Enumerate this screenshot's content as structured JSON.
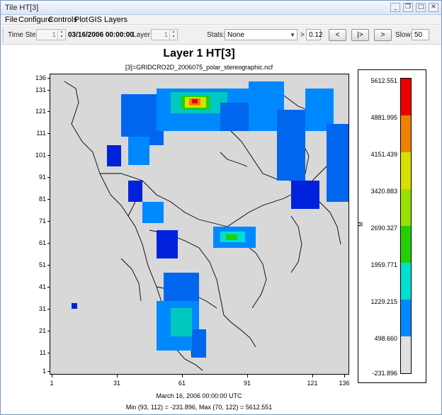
{
  "window": {
    "title": "Tile HT[3]",
    "minimize_glyph": "_",
    "restore_glyph": "❐",
    "maximize_glyph": "□",
    "close_glyph": "✕"
  },
  "menu": [
    {
      "label": "File"
    },
    {
      "label": "Configure"
    },
    {
      "label": "Controls"
    },
    {
      "label": "Plot"
    },
    {
      "label": "GIS Layers"
    }
  ],
  "toolbar": {
    "time_step_label": "Time Step:",
    "time_step_value": "1",
    "date_value": "03/16/2006 00:00:00",
    "layer_label": "Layer:",
    "layer_value": "1",
    "stats_label": "Stats:",
    "stats_value": "None",
    "gt_label": ">",
    "threshold_value": "0.12",
    "prev_label": "<",
    "play_label": "|>",
    "next_label": ">",
    "slow_label": "Slow:",
    "slow_value": "50"
  },
  "plot": {
    "title": "Layer 1 HT[3]",
    "subtitle": "[3]=GRIDCRO2D_2006075_polar_stereographic.ncf",
    "y_ticks": [
      "136",
      "131",
      "121",
      "111",
      "101",
      "91",
      "81",
      "71",
      "61",
      "51",
      "41",
      "31",
      "21",
      "11",
      "1"
    ],
    "x_ticks": [
      "1",
      "31",
      "61",
      "91",
      "121",
      "136"
    ],
    "footer_time": "March 16, 2006 00:00:00 UTC",
    "footer_minmax": "Min (93, 112) = -231.896, Max (70, 122) = 5612.551"
  },
  "legend": {
    "unit": "M",
    "labels": [
      "5612.551",
      "4881.995",
      "4151.439",
      "3420.883",
      "2690.327",
      "1959.771",
      "1229.215",
      "498.660",
      "-231.896"
    ],
    "colors": [
      "#ee0000",
      "#f08000",
      "#d8e000",
      "#9ae000",
      "#22d000",
      "#00e0d0",
      "#0088ff",
      "#0022dd",
      "#e0e0e0"
    ]
  },
  "chart_data": {
    "type": "heatmap",
    "title": "Layer 1 HT[3]",
    "subtitle": "[3]=GRIDCRO2D_2006075_polar_stereographic.ncf",
    "x_ticks": [
      1,
      31,
      61,
      91,
      121,
      136
    ],
    "y_ticks": [
      1,
      11,
      21,
      31,
      41,
      51,
      61,
      71,
      81,
      91,
      101,
      111,
      121,
      131,
      136
    ],
    "xlim": [
      1,
      136
    ],
    "ylim": [
      1,
      136
    ],
    "color_scale": {
      "breaks": [
        -231.896,
        498.66,
        1229.215,
        1959.771,
        2690.327,
        3420.883,
        4151.439,
        4881.995,
        5612.551
      ],
      "colors": [
        "#e0e0e0",
        "#0022dd",
        "#0088ff",
        "#00e0d0",
        "#22d000",
        "#9ae000",
        "#d8e000",
        "#f08000",
        "#ee0000"
      ],
      "unit": "M"
    },
    "min": {
      "col": 93,
      "row": 112,
      "value": -231.896
    },
    "max": {
      "col": 70,
      "row": 122,
      "value": 5612.551
    },
    "time": "March 16, 2006 00:00:00 UTC"
  }
}
